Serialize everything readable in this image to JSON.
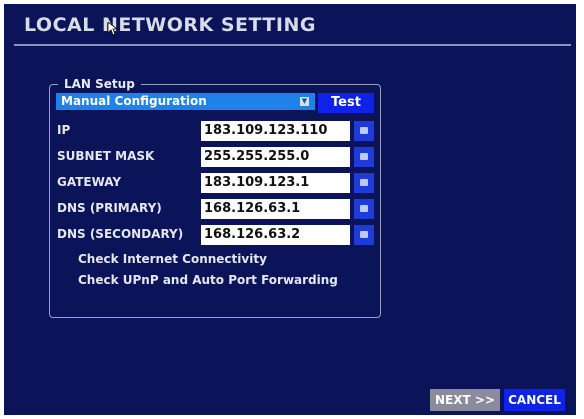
{
  "title": "LOCAL NETWORK SETTING",
  "lan_setup": {
    "legend": "LAN Setup",
    "config_mode": "Manual Configuration",
    "test_label": "Test",
    "rows": [
      {
        "label": "IP",
        "value": "183.109.123.110"
      },
      {
        "label": "SUBNET MASK",
        "value": "255.255.255.0"
      },
      {
        "label": "GATEWAY",
        "value": "183.109.123.1"
      },
      {
        "label": "DNS (PRIMARY)",
        "value": "168.126.63.1"
      },
      {
        "label": "DNS (SECONDARY)",
        "value": "168.126.63.2"
      }
    ],
    "check_internet": "Check Internet Connectivity",
    "check_upnp": "Check UPnP and Auto Port Forwarding"
  },
  "footer": {
    "next_label": "NEXT >>",
    "cancel_label": "CANCEL"
  },
  "colors": {
    "background": "#0b1458",
    "select_accent": "#1e82e8",
    "button_blue": "#0f22e8",
    "button_disabled": "#8a8c9e"
  },
  "icons": {
    "dropdown": "chevron-down-icon",
    "keyboard": "keyboard-icon",
    "cursor": "mouse-cursor-icon"
  }
}
